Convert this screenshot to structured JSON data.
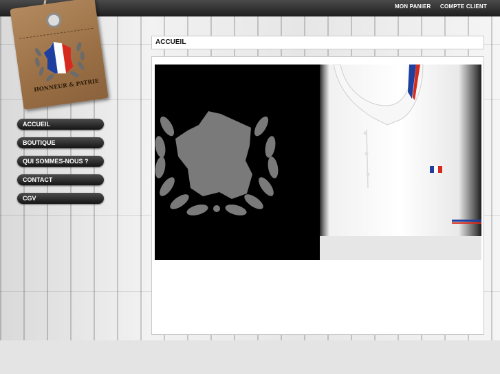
{
  "top_nav": {
    "cart": "MON PANIER",
    "account": "COMPTE CLIENT"
  },
  "logo": {
    "text": "HONNEUR & PATRIE",
    "flag_colors": [
      "#1f3f9e",
      "#ffffff",
      "#d52b1e"
    ]
  },
  "menu": [
    {
      "label": "ACCUEIL"
    },
    {
      "label": "BOUTIQUE"
    },
    {
      "label": "QUI SOMMES-NOUS ?"
    },
    {
      "label": "CONTACT"
    },
    {
      "label": "CGV"
    }
  ],
  "page": {
    "title": "ACCUEIL"
  },
  "hero": {
    "left_graphic": "laurel-wreath-france-map",
    "right_photo": "white-polo-shirt"
  }
}
